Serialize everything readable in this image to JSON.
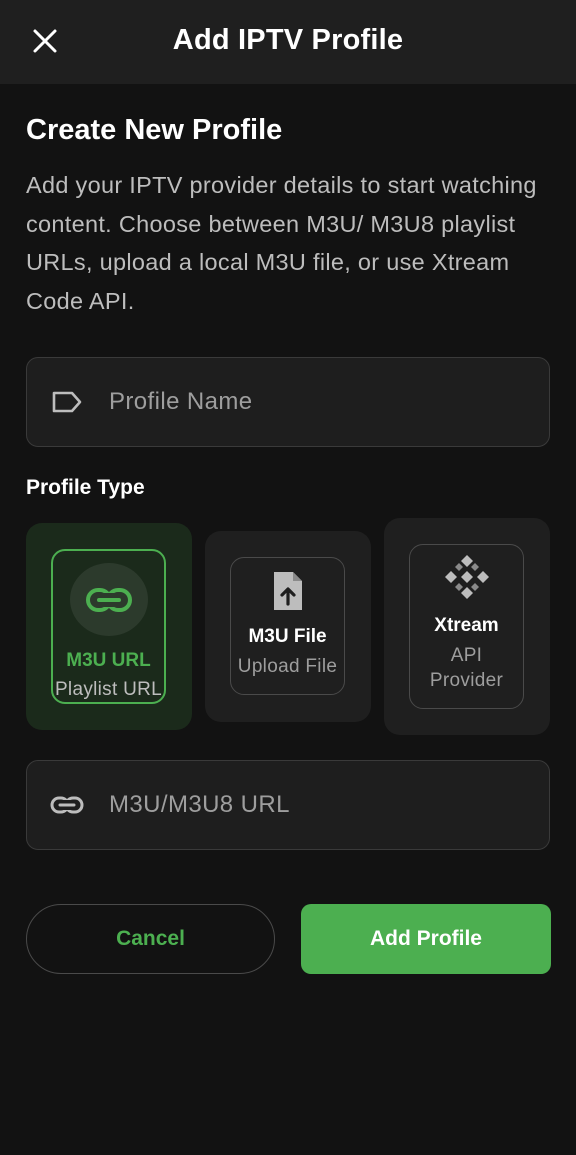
{
  "header": {
    "title": "Add IPTV Profile"
  },
  "intro": {
    "title": "Create New Profile",
    "description": "Add your IPTV provider details to start watching content. Choose between M3U/ M3U8 playlist URLs, upload a local M3U file, or use Xtream Code API."
  },
  "profile_name": {
    "placeholder": "Profile Name",
    "value": "",
    "icon": "label-tag-icon"
  },
  "profile_type": {
    "label": "Profile Type",
    "selected": "m3u_url",
    "options": [
      {
        "id": "m3u_url",
        "name": "M3U URL",
        "subtitle": "Playlist URL",
        "icon": "link-icon"
      },
      {
        "id": "m3u_file",
        "name": "M3U File",
        "subtitle": "Upload File",
        "icon": "file-upload-icon"
      },
      {
        "id": "xtream",
        "name": "Xtream",
        "subtitle": "API Provider",
        "icon": "api-diamond-icon"
      }
    ]
  },
  "url_field": {
    "placeholder": "M3U/M3U8 URL",
    "value": "",
    "icon": "link-icon"
  },
  "actions": {
    "cancel_label": "Cancel",
    "add_label": "Add Profile"
  },
  "colors": {
    "accent": "#4caf50",
    "background": "#121212",
    "surface": "#1f1f1f"
  }
}
